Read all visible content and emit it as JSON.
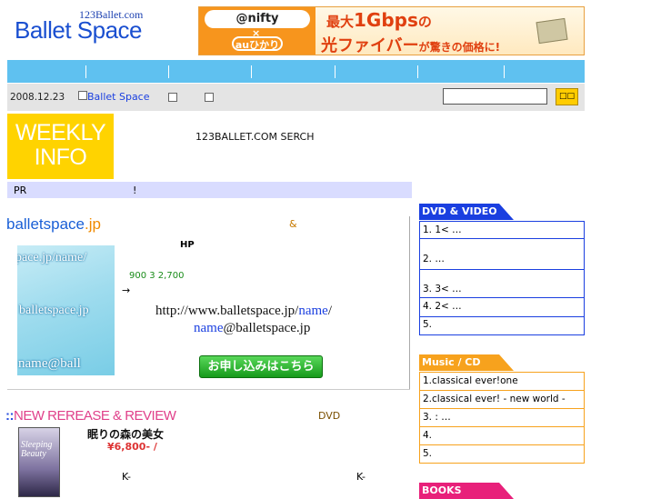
{
  "header": {
    "logo_sub": "123Ballet.com",
    "logo_main": "Ballet Space",
    "banner": {
      "nifty": "@nifty",
      "cross": "×",
      "au": "auひかり",
      "line1_prefix": "最大",
      "line1_big": "1Gbps",
      "line1_suffix": "の",
      "line2_main": "光ファイバー",
      "line2_small": "が驚きの価格に!"
    }
  },
  "breadcrumb": {
    "date": "2008.12.23",
    "link": "Ballet Space"
  },
  "search": {
    "placeholder": "",
    "button": "□□"
  },
  "weekly_info": {
    "line1": "WEEKLY",
    "line2": "INFO"
  },
  "serch_text": "123BALLET.COM SERCH",
  "pr": {
    "label": "PR",
    "mark": "!"
  },
  "balletspace": {
    "title_main": "balletspace",
    "title_suffix": ".jp",
    "amp": "&",
    "hp": "HP",
    "image_text_top": "pace.jp/name/",
    "image_text_mid": "balletspace.jp",
    "image_text_bottom": "name@ball",
    "price": "900  3  2,700",
    "arrow": "→",
    "url_prefix": "http://www.balletspace.jp/",
    "url_seg": "name",
    "url_suffix": "/",
    "email_seg": "name",
    "email_suffix": "@balletspace.jp",
    "apply_button": "お申し込みはこちら"
  },
  "new_release": {
    "dots": "::",
    "title": "NEW REREASE & REVIEW",
    "dvd_label": "DVD",
    "cover_text": "Sleeping Beauty",
    "item_title": "眠りの森の美女",
    "item_price": "¥6,800- /",
    "k1": "K-",
    "k2": "K-"
  },
  "right_column": {
    "dvd": {
      "title": "DVD & VIDEO",
      "color": "#1a3fe0",
      "rows": [
        "1.          1<    …",
        "2.                 …",
        "3.          3<    …",
        "4.          2<    …",
        "5."
      ]
    },
    "music": {
      "title": "Music / CD",
      "color": "#f7a21d",
      "rows": [
        "1.classical ever!one",
        "2.classical ever! - new world -",
        "3.         :      …",
        "4.",
        "5."
      ]
    },
    "books": {
      "title": "BOOKS",
      "color": "#e8207a"
    }
  }
}
